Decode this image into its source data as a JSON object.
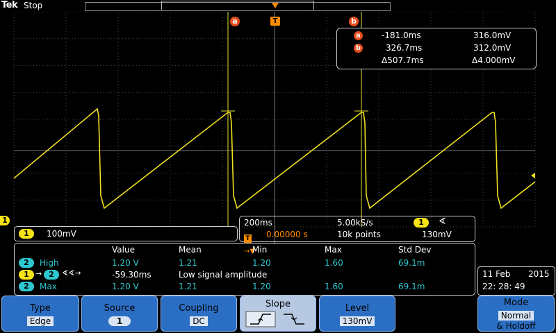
{
  "topbar": {
    "brand": "Tek",
    "state": "Stop"
  },
  "cursors": {
    "a_label": "a",
    "b_label": "b",
    "trigger_label": "T",
    "readout": {
      "a": {
        "time": "-181.0ms",
        "value": "316.0mV"
      },
      "b": {
        "time": "326.7ms",
        "value": "312.0mV"
      },
      "delta": {
        "time": "Δ507.7ms",
        "value": "Δ4.000mV"
      }
    }
  },
  "channel": {
    "number": "1",
    "scale": "100mV"
  },
  "timebase": {
    "scale": "200ms",
    "sample_rate": "5.00kS/s",
    "trigger_pos": "0.00000 s",
    "record": "10k points",
    "trig_source": "1",
    "trig_level": "130mV"
  },
  "measurements": {
    "headers": [
      "Value",
      "Mean",
      "Min",
      "Max",
      "Std Dev"
    ],
    "rows": [
      {
        "badge": "2",
        "name": "High",
        "value": "1.20 V",
        "mean": "1.21",
        "min": "1.20",
        "max": "1.60",
        "std": "69.1m"
      },
      {
        "badge1": "1",
        "badge2": "2",
        "value": "-59.30ms",
        "note": "Low signal amplitude"
      },
      {
        "badge": "2",
        "name": "Max",
        "value": "1.20 V",
        "mean": "1.21",
        "min": "1.20",
        "max": "1.60",
        "std": "69.1m"
      }
    ]
  },
  "datetime": {
    "date": "11 Feb",
    "year": "2015",
    "time": "22: 28: 49"
  },
  "menu": {
    "type": {
      "label": "Type",
      "value": "Edge"
    },
    "source": {
      "label": "Source",
      "value": "1"
    },
    "coupling": {
      "label": "Coupling",
      "value": "DC"
    },
    "slope": {
      "label": "Slope"
    },
    "level": {
      "label": "Level",
      "value": "130mV"
    },
    "mode": {
      "label": "Mode",
      "value": "Normal",
      "suffix": "& Holdoff"
    }
  },
  "colors": {
    "trace": "#f0e020",
    "cursor": "#e84d1c",
    "trigger": "#ff8c00",
    "ch2": "#2ec8d0",
    "menu": "#2b6fc4"
  }
}
